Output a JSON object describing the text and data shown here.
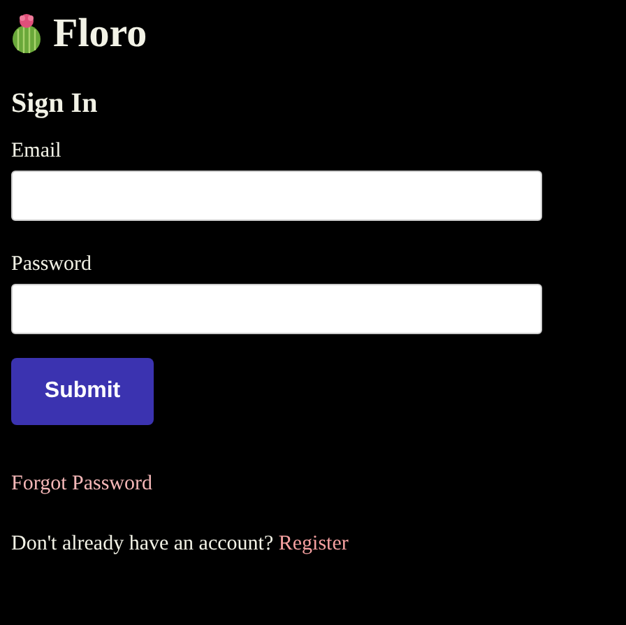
{
  "brand": {
    "name": "Floro"
  },
  "form": {
    "title": "Sign In",
    "fields": [
      {
        "label": "Email"
      },
      {
        "label": "Password"
      }
    ],
    "submit": "Submit"
  },
  "forgot_link": "Forgot Password",
  "register": {
    "prompt": "Don't already have an account?",
    "link": "Register"
  }
}
